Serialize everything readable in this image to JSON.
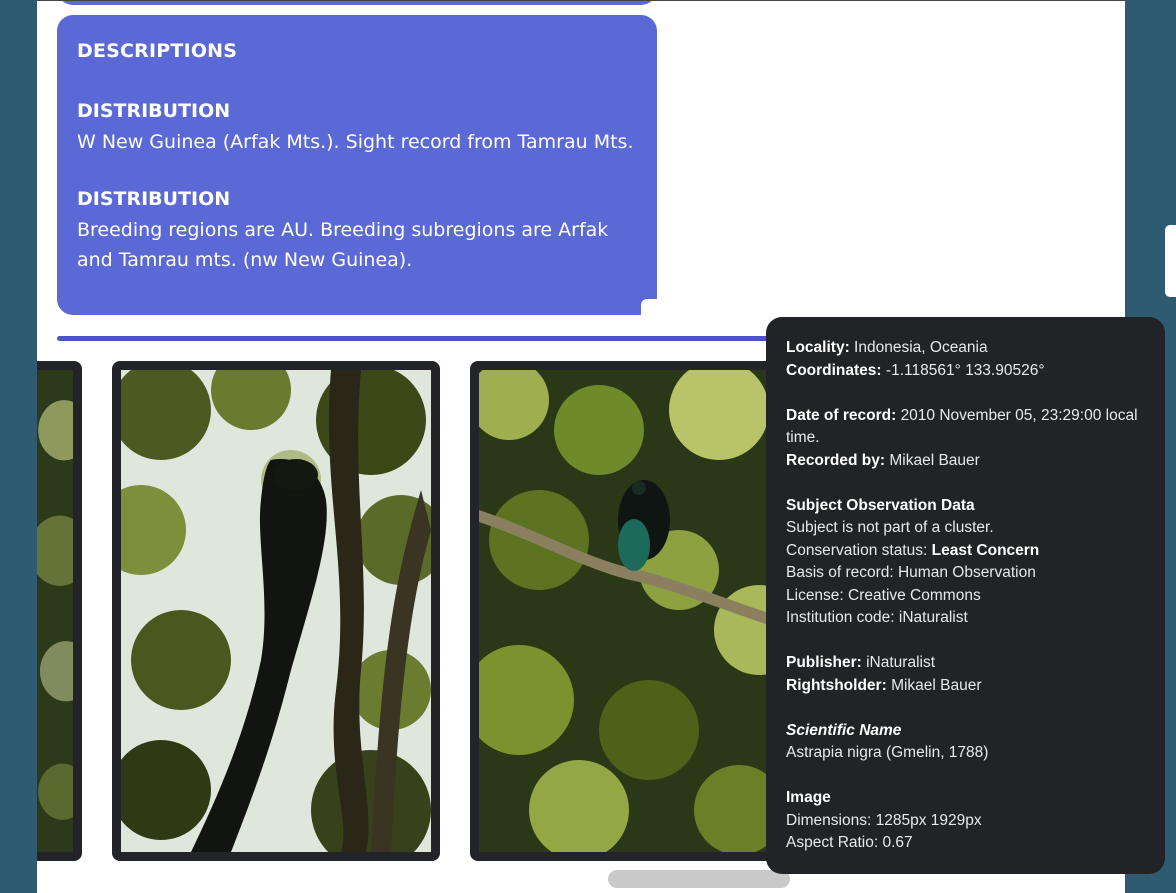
{
  "descriptions": {
    "title": "DESCRIPTIONS",
    "sections": [
      {
        "heading": "DISTRIBUTION",
        "text": "W New Guinea (Arfak Mts.). Sight record from Tamrau Mts."
      },
      {
        "heading": "DISTRIBUTION",
        "text": "Breeding regions are AU. Breeding subregions are Arfak and Tamrau mts. (nw New Guinea)."
      }
    ]
  },
  "tooltip": {
    "locality_label": "Locality:",
    "locality_value": "Indonesia, Oceania",
    "coordinates_label": "Coordinates:",
    "coordinates_value": "-1.118561° 133.90526°",
    "date_label": "Date of record:",
    "date_value": "2010 November 05, 23:29:00 local time.",
    "recorded_by_label": "Recorded by:",
    "recorded_by_value": "Mikael Bauer",
    "subject_heading": "Subject Observation Data",
    "cluster_text": "Subject is not part of a cluster.",
    "conservation_label": "Conservation status:",
    "conservation_value": "Least Concern",
    "basis_text": "Basis of record: Human Observation",
    "license_text": "License: Creative Commons",
    "institution_text": "Institution code: iNaturalist",
    "publisher_label": "Publisher:",
    "publisher_value": "iNaturalist",
    "rightsholder_label": "Rightsholder:",
    "rightsholder_value": "Mikael Bauer",
    "scientific_heading": "Scientific Name",
    "scientific_value": "Astrapia nigra (Gmelin, 1788)",
    "image_heading": "Image",
    "dimensions_text": "Dimensions: 1285px 1929px",
    "aspect_text": "Aspect Ratio: 0.67"
  },
  "colors": {
    "page_background": "#2e5a72",
    "description_card": "#5b69d6",
    "tooltip_background": "#212327",
    "photo_frame": "#23242a"
  }
}
